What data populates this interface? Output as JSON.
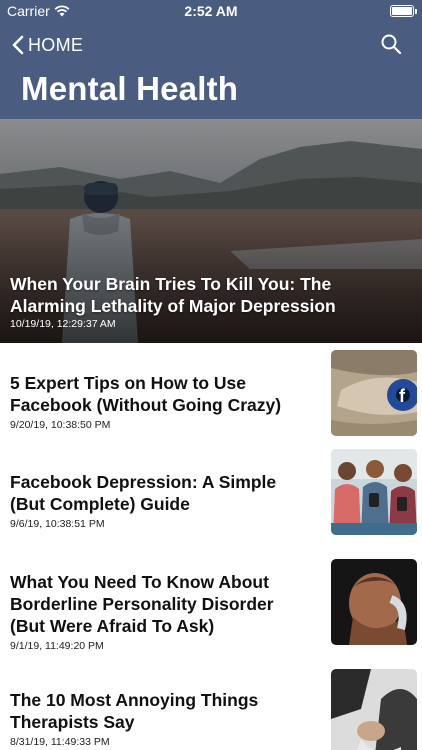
{
  "status_bar": {
    "carrier": "Carrier",
    "time": "2:52 AM"
  },
  "nav": {
    "back_label": "HOME"
  },
  "page_title": "Mental Health",
  "hero": {
    "title": "When Your Brain Tries To Kill You: The Alarming Lethality of Major Depression",
    "date": "10/19/19, 12:29:37 AM"
  },
  "articles": [
    {
      "title": "5 Expert Tips on How to Use Facebook (Without Going Crazy)",
      "date": "9/20/19, 10:38:50 PM"
    },
    {
      "title": "Facebook Depression: A Simple (But Complete) Guide",
      "date": "9/6/19, 10:38:51 PM"
    },
    {
      "title": "What You Need To Know About Borderline Personality Disorder (But Were Afraid To Ask)",
      "date": "9/1/19, 11:49:20 PM"
    },
    {
      "title": "The 10 Most Annoying Things Therapists Say",
      "date": "8/31/19, 11:49:33 PM"
    }
  ],
  "icons": {
    "back": "chevron-left-icon",
    "search": "search-icon",
    "wifi": "wifi-icon",
    "battery": "battery-icon"
  },
  "colors": {
    "header": "#4a5d80",
    "text": "#111111"
  }
}
